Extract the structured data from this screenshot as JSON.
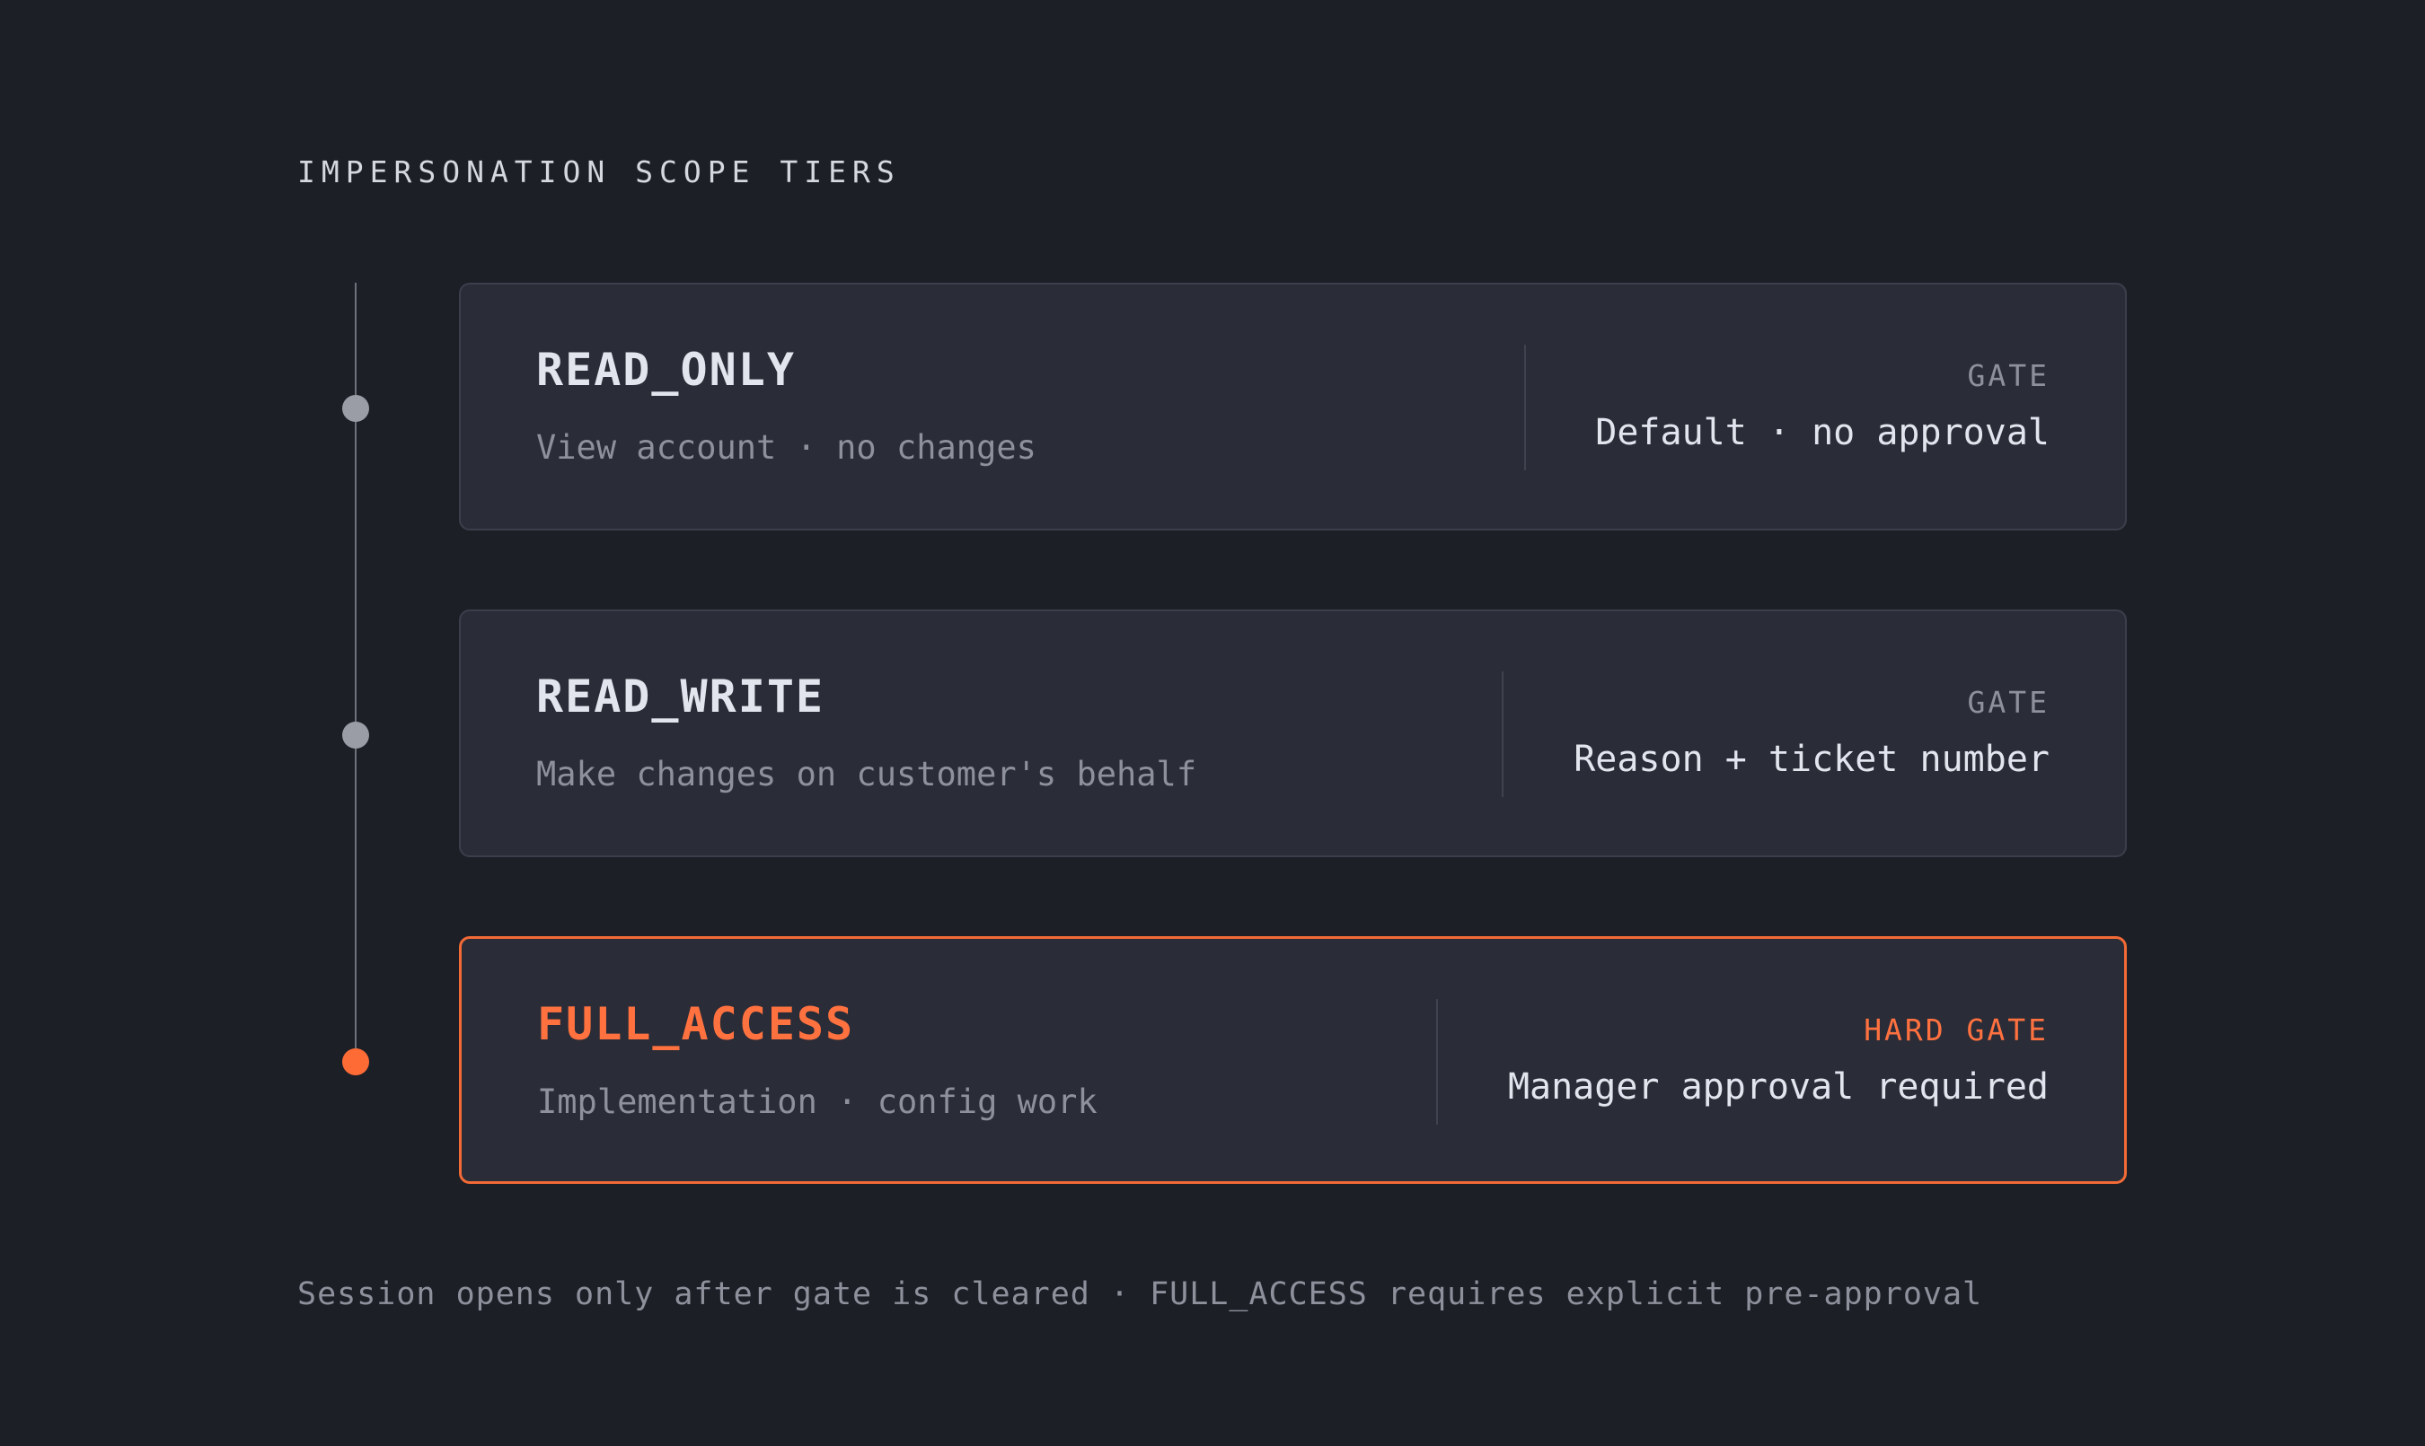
{
  "heading": "IMPERSONATION SCOPE TIERS",
  "tiers": [
    {
      "name": "READ_ONLY",
      "description": "View account · no changes",
      "gate_label": "GATE",
      "gate_value": "Default · no approval",
      "highlighted": false
    },
    {
      "name": "READ_WRITE",
      "description": "Make changes on customer's behalf",
      "gate_label": "GATE",
      "gate_value": "Reason + ticket number",
      "highlighted": false
    },
    {
      "name": "FULL_ACCESS",
      "description": "Implementation · config work",
      "gate_label": "HARD GATE",
      "gate_value": "Manager approval required",
      "highlighted": true
    }
  ],
  "footer": "Session opens only after gate is cleared · FULL_ACCESS requires explicit pre-approval",
  "colors": {
    "background": "#1d1f27",
    "card": "#2a2c37",
    "accent": "#ff6b35",
    "muted": "#8e909b",
    "text": "#e3e5ee"
  }
}
